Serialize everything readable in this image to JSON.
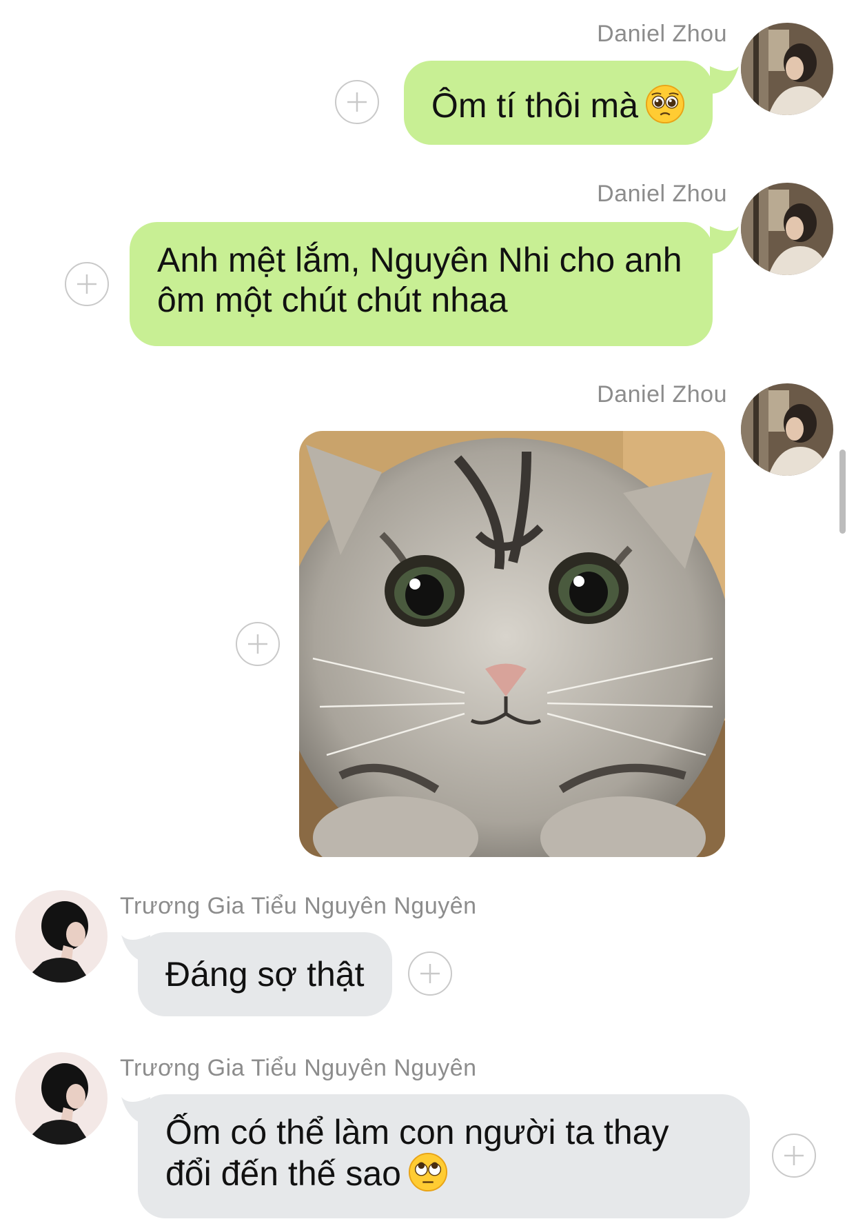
{
  "messages": [
    {
      "direction": "outgoing",
      "sender": "Daniel Zhou",
      "text": "Ôm tí thôi mà",
      "emoji_icon": "pleading-face-icon"
    },
    {
      "direction": "outgoing",
      "sender": "Daniel Zhou",
      "text": "Anh mệt lắm, Nguyên Nhi cho anh ôm một chút chút nhaa"
    },
    {
      "direction": "outgoing",
      "sender": "Daniel Zhou",
      "attachment": "photo",
      "photo_icon": "sad-cat-photo"
    },
    {
      "direction": "incoming",
      "sender": "Trương Gia Tiểu Nguyên Nguyên",
      "text": "Đáng sợ thật"
    },
    {
      "direction": "incoming",
      "sender": "Trương Gia Tiểu Nguyên Nguyên",
      "text": "Ốm có thể làm con người ta thay đổi đến thế sao",
      "emoji_icon": "face-with-rolling-eyes-icon"
    }
  ],
  "icons": {
    "add_button": "plus-circle-icon",
    "outgoing_avatar": "avatar-daniel-zhou",
    "incoming_avatar": "avatar-truong-gia-tieu-nguyen-nguyen"
  },
  "colors": {
    "outgoing_bubble": "#c8ef94",
    "incoming_bubble": "#e6e8ea",
    "sender_name": "#8c8c8c",
    "background": "#ffffff"
  }
}
